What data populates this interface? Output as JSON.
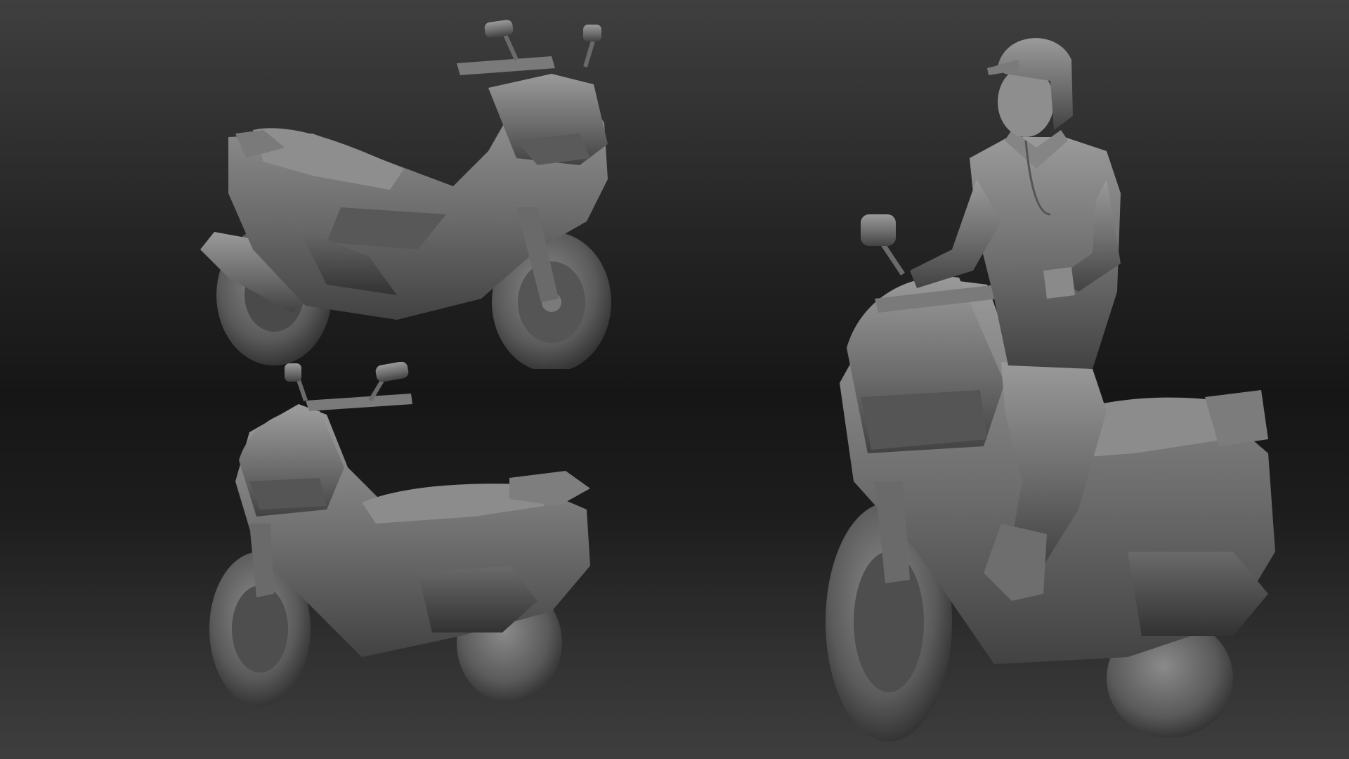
{
  "scene": {
    "icons": [
      "scooter-side-icon",
      "scooter-front-icon",
      "rider-on-scooter-icon"
    ],
    "colors": {
      "background_top": "#3f3f3f",
      "background_mid": "#161616",
      "background_bottom": "#3e3e3e",
      "matcap_light": "#9a9a9a",
      "matcap_base": "#6d6d6d",
      "matcap_dark": "#3a3a3a"
    }
  }
}
